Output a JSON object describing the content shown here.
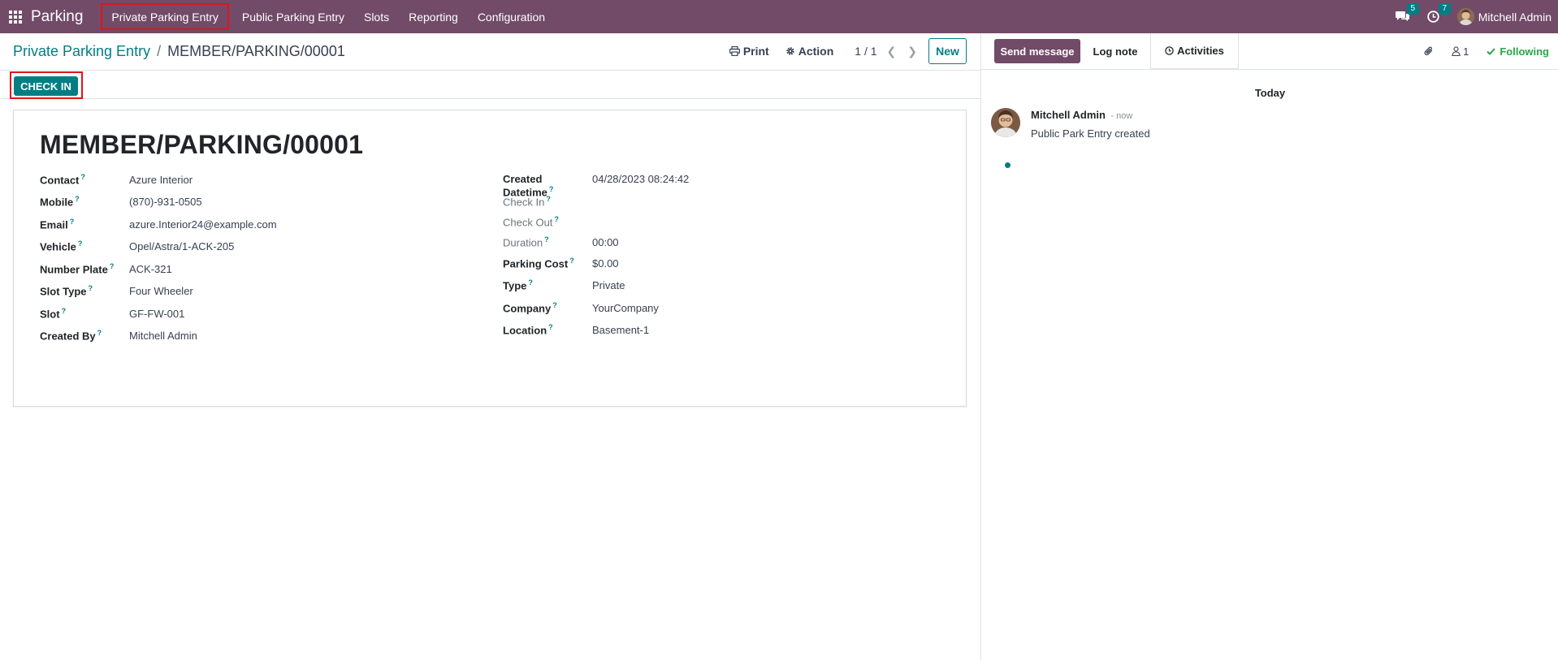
{
  "navbar": {
    "app_name": "Parking",
    "menu": [
      {
        "label": "Private Parking Entry"
      },
      {
        "label": "Public Parking Entry"
      },
      {
        "label": "Slots"
      },
      {
        "label": "Reporting"
      },
      {
        "label": "Configuration"
      }
    ],
    "messages_count": "5",
    "activities_count": "7",
    "user_name": "Mitchell Admin",
    "color": "#714b67"
  },
  "control": {
    "breadcrumb_parent": "Private Parking Entry",
    "breadcrumb_sep": "/",
    "breadcrumb_current": "MEMBER/PARKING/00001",
    "print_label": "Print",
    "action_label": "Action",
    "pager": "1 / 1",
    "new_label": "New"
  },
  "statusbar": {
    "checkin_label": "CHECK IN"
  },
  "record": {
    "title": "MEMBER/PARKING/00001",
    "left_fields": [
      {
        "label": "Contact",
        "value": "Azure Interior"
      },
      {
        "label": "Mobile",
        "value": "(870)-931-0505"
      },
      {
        "label": "Email",
        "value": "azure.Interior24@example.com"
      },
      {
        "label": "Vehicle",
        "value": "Opel/Astra/1-ACK-205"
      },
      {
        "label": "Number Plate",
        "value": "ACK-321"
      },
      {
        "label": "Slot Type",
        "value": "Four Wheeler"
      },
      {
        "label": "Slot",
        "value": "GF-FW-001"
      },
      {
        "label": "Created By",
        "value": "Mitchell Admin"
      }
    ],
    "right_fields": [
      {
        "label": "Created Datetime",
        "value": "04/28/2023 08:24:42"
      },
      {
        "label": "Check In",
        "value": ""
      },
      {
        "label": "Check Out",
        "value": ""
      },
      {
        "label": "Duration",
        "value": "00:00"
      },
      {
        "label": "Parking Cost",
        "value": "$0.00"
      },
      {
        "label": "Type",
        "value": "Private"
      },
      {
        "label": "Company",
        "value": "YourCompany"
      },
      {
        "label": "Location",
        "value": "Basement-1"
      }
    ],
    "help_mark": "?"
  },
  "chatter": {
    "send_message": "Send message",
    "log_note": "Log note",
    "activities": "Activities",
    "followers_count": "1",
    "following_label": "Following",
    "day_label": "Today",
    "message": {
      "author": "Mitchell Admin",
      "time": "- now",
      "body": "Public Park Entry created"
    }
  },
  "icons": {
    "apps": "apps-grid-icon",
    "messages": "chat-bubbles-icon",
    "activities": "clock-icon",
    "print": "printer-icon",
    "action": "gear-icon",
    "prev": "chevron-left-icon",
    "next": "chevron-right-icon",
    "attachment": "paperclip-icon",
    "followers": "user-icon",
    "following": "check-icon"
  },
  "colors": {
    "brand": "#714b67",
    "accent": "#017e84",
    "success": "#28a745",
    "highlight": "#e0141e"
  }
}
